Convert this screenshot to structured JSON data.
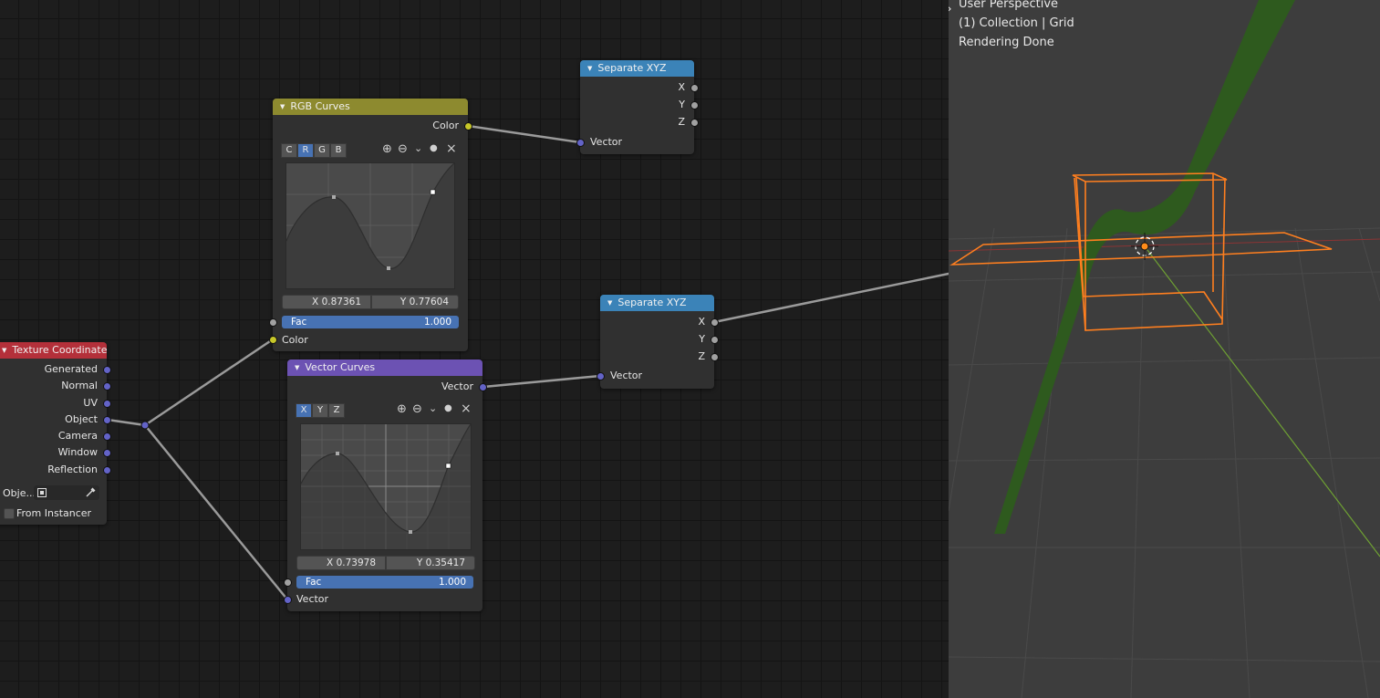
{
  "colors": {
    "accent_blue": "#4772b3",
    "header_curves_rgb": "#8d8a2f",
    "header_curves_vector": "#6c52b3",
    "header_separate": "#3b83b8",
    "header_texture": "#b4303a",
    "socket_gray": "#a1a1a1",
    "socket_yellow": "#c7c729",
    "socket_blue": "#6363c7",
    "selection_orange": "#ff7f1f"
  },
  "nodes": {
    "texture_coordinate": {
      "title": "Texture Coordinate",
      "outputs": [
        "Generated",
        "Normal",
        "UV",
        "Object",
        "Camera",
        "Window",
        "Reflection"
      ],
      "object_label": "Obje...",
      "from_instancer_label": "From Instancer",
      "object_field_icon": "object-icon",
      "eyedropper_icon": "eyedropper-icon"
    },
    "rgb_curves": {
      "title": "RGB Curves",
      "output_label": "Color",
      "tabs": [
        "C",
        "R",
        "G",
        "B"
      ],
      "active_tab": "R",
      "x_value": "X 0.87361",
      "y_value": "Y 0.77604",
      "fac_label": "Fac",
      "fac_value": "1.000",
      "input_label": "Color"
    },
    "vector_curves": {
      "title": "Vector Curves",
      "output_label": "Vector",
      "tabs": [
        "X",
        "Y",
        "Z"
      ],
      "active_tab": "X",
      "x_value": "X 0.73978",
      "y_value": "Y 0.35417",
      "fac_label": "Fac",
      "fac_value": "1.000",
      "input_label": "Vector"
    },
    "separate_xyz_1": {
      "title": "Separate XYZ",
      "outputs": [
        "X",
        "Y",
        "Z"
      ],
      "input_label": "Vector"
    },
    "separate_xyz_2": {
      "title": "Separate XYZ",
      "outputs": [
        "X",
        "Y",
        "Z"
      ],
      "input_label": "Vector"
    }
  },
  "curve_tools": {
    "zoom_in": "⊕",
    "zoom_out": "⊖",
    "dropdown": "⌄",
    "dot": "●",
    "close": "×"
  },
  "viewport": {
    "line1": "User Perspective",
    "line2": "(1) Collection | Grid",
    "line3": "Rendering Done",
    "toggle_icon": "›"
  }
}
